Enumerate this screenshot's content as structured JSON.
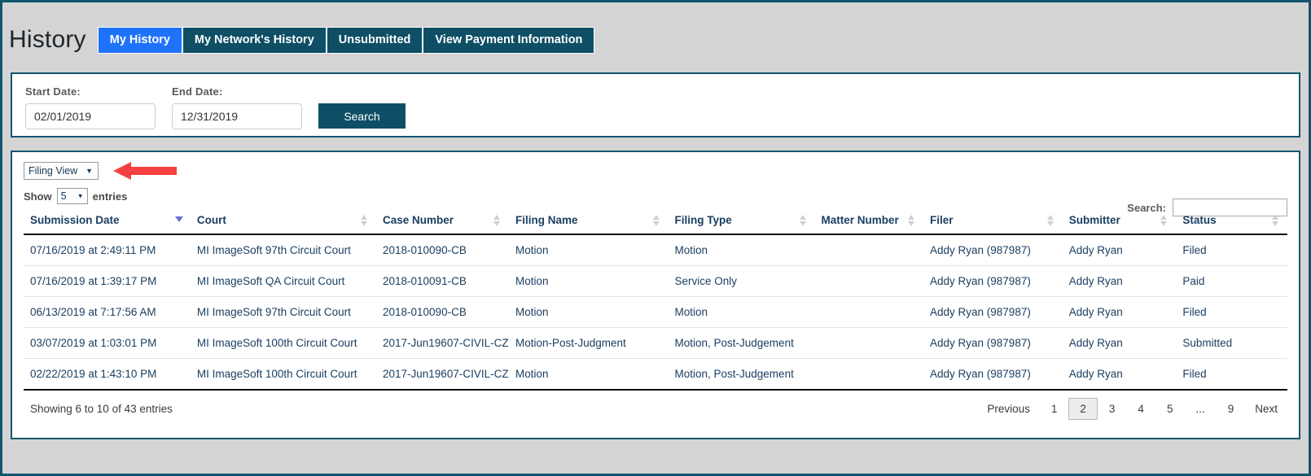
{
  "header": {
    "title": "History",
    "tabs": [
      {
        "label": "My History",
        "active": true
      },
      {
        "label": "My Network's History",
        "active": false
      },
      {
        "label": "Unsubmitted",
        "active": false
      },
      {
        "label": "View Payment Information",
        "active": false
      }
    ]
  },
  "search_panel": {
    "start_date_label": "Start Date:",
    "start_date_value": "02/01/2019",
    "start_date_placeholder": "mm/dd/yyyy",
    "end_date_label": "End Date:",
    "end_date_value": "12/31/2019",
    "end_date_placeholder": "mm/dd/yyyy",
    "search_button": "Search"
  },
  "results_panel": {
    "view_select_value": "Filing View",
    "view_select_caret": "▼",
    "show_label": "Show",
    "entries_value": "5",
    "entries_caret": "▼",
    "entries_label": "entries",
    "search_label": "Search:",
    "search_value": "",
    "search_placeholder": "",
    "columns": [
      {
        "label": "Submission Date",
        "sort": "desc"
      },
      {
        "label": "Court",
        "sort": "none"
      },
      {
        "label": "Case Number",
        "sort": "none"
      },
      {
        "label": "Filing Name",
        "sort": "none"
      },
      {
        "label": "Filing Type",
        "sort": "none"
      },
      {
        "label": "Matter Number",
        "sort": "none"
      },
      {
        "label": "Filer",
        "sort": "none"
      },
      {
        "label": "Submitter",
        "sort": "none"
      },
      {
        "label": "Status",
        "sort": "none"
      }
    ],
    "rows": [
      {
        "submission_date": "07/16/2019 at 2:49:11 PM",
        "court": "MI ImageSoft 97th Circuit Court",
        "case_number": "2018-010090-CB",
        "filing_name": "Motion",
        "filing_type": "Motion",
        "matter_number": "",
        "filer": "Addy Ryan (987987)",
        "submitter": "Addy Ryan",
        "status": "Filed"
      },
      {
        "submission_date": "07/16/2019 at 1:39:17 PM",
        "court": "MI ImageSoft QA Circuit Court",
        "case_number": "2018-010091-CB",
        "filing_name": "Motion",
        "filing_type": "Service Only",
        "matter_number": "",
        "filer": "Addy Ryan (987987)",
        "submitter": "Addy Ryan",
        "status": "Paid"
      },
      {
        "submission_date": "06/13/2019 at 7:17:56 AM",
        "court": "MI ImageSoft 97th Circuit Court",
        "case_number": "2018-010090-CB",
        "filing_name": "Motion",
        "filing_type": "Motion",
        "matter_number": "",
        "filer": "Addy Ryan (987987)",
        "submitter": "Addy Ryan",
        "status": "Filed"
      },
      {
        "submission_date": "03/07/2019 at 1:03:01 PM",
        "court": "MI ImageSoft 100th Circuit Court",
        "case_number": "2017-Jun19607-CIVIL-CZ",
        "filing_name": "Motion-Post-Judgment",
        "filing_type": "Motion, Post-Judgement",
        "matter_number": "",
        "filer": "Addy Ryan (987987)",
        "submitter": "Addy Ryan",
        "status": "Submitted"
      },
      {
        "submission_date": "02/22/2019 at 1:43:10 PM",
        "court": "MI ImageSoft 100th Circuit Court",
        "case_number": "2017-Jun19607-CIVIL-CZ",
        "filing_name": "Motion",
        "filing_type": "Motion, Post-Judgement",
        "matter_number": "",
        "filer": "Addy Ryan (987987)",
        "submitter": "Addy Ryan",
        "status": "Filed"
      }
    ],
    "showing_info": "Showing 6 to 10 of 43 entries",
    "pagination": {
      "previous_label": "Previous",
      "next_label": "Next",
      "pages": [
        "1",
        "2",
        "3",
        "4",
        "5",
        "...",
        "9"
      ],
      "active_page": "2"
    }
  },
  "annotation": {
    "arrow_icon": "left-arrow-annotation",
    "arrow_color": "#f4413f"
  },
  "colors": {
    "tab_active": "#1f73fb",
    "tab_inactive": "#0e4f66",
    "panel_border": "#12566e",
    "page_bg": "#d4d4d4",
    "text_primary": "#1b3f62"
  }
}
